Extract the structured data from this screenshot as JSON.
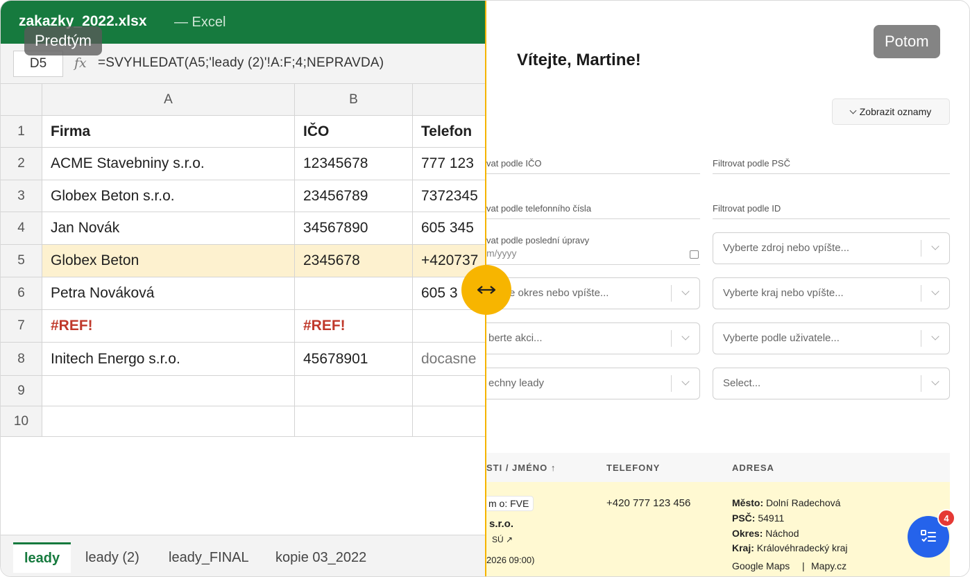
{
  "excel": {
    "file_name": "zakazky_2022.xlsx",
    "app_name": "— Excel",
    "cell_ref": "D5",
    "fx_label": "fx",
    "formula": "=SVYHLEDAT(A5;'leady (2)'!A:F;4;NEPRAVDA)",
    "columns": [
      "A",
      "B",
      ""
    ],
    "rows": [
      {
        "num": "1",
        "a": "Firma",
        "b": "IČO",
        "c": "Telefon"
      },
      {
        "num": "2",
        "a": "ACME Stavebniny s.r.o.",
        "b": "12345678",
        "c": "777 123"
      },
      {
        "num": "3",
        "a": "Globex Beton s.r.o.",
        "b": "23456789",
        "c": "7372345"
      },
      {
        "num": "4",
        "a": "Jan Novák",
        "b": "34567890",
        "c": "605 345"
      },
      {
        "num": "5",
        "a": "Globex Beton",
        "b": "2345678",
        "c": "+420737"
      },
      {
        "num": "6",
        "a": "Petra Nováková",
        "b": "",
        "c": "605 3"
      },
      {
        "num": "7",
        "a": "#REF!",
        "b": "#REF!",
        "c": ""
      },
      {
        "num": "8",
        "a": "Initech Energo s.r.o.",
        "b": "45678901",
        "c": "docasne"
      },
      {
        "num": "9",
        "a": "",
        "b": "",
        "c": ""
      },
      {
        "num": "10",
        "a": "",
        "b": "",
        "c": ""
      }
    ],
    "sheet_tabs": [
      "leady",
      "leady (2)",
      "leady_FINAL",
      "kopie 03_2022"
    ],
    "accent": "#167a3e"
  },
  "labels": {
    "before": "Predtým",
    "after": "Potom"
  },
  "app": {
    "welcome": "Vítejte, Martine!",
    "announce_button": "Zobrazit oznamy",
    "filters": {
      "ico": "vat podle IČO",
      "psc": "Filtrovat podle PSČ",
      "phone": "vat podle telefonního čísla",
      "id": "Filtrovat podle ID",
      "last_edit": "vat podle poslední úpravy",
      "date_placeholder": "m/yyyy"
    },
    "selects": {
      "source": "Vyberte zdroj nebo vpíšte...",
      "district": "e okres nebo vpíšte...",
      "region": "Vyberte kraj nebo vpíšte...",
      "action": "berte akci...",
      "user": "Vyberte podle uživatele...",
      "leads": "echny leady",
      "generic": "Select..."
    },
    "table": {
      "col_name": "STI / JMÉNO ↑",
      "col_phones": "TELEFONY",
      "col_address": "ADRESA",
      "row": {
        "tag": "m o: FVE",
        "company": "s.r.o.",
        "subtitle": "SÚ ↗",
        "date": "2026 09:00)",
        "phone": "+420 777 123 456",
        "city_label": "Město:",
        "city": "Dolní Radechová",
        "psc_label": "PSČ:",
        "psc": "54911",
        "district_label": "Okres:",
        "district": "Náchod",
        "region_label": "Kraj:",
        "region": "Královéhradecký kraj",
        "map1": "Google Maps",
        "map_sep": "|",
        "map2": "Mapy.cz"
      }
    },
    "fab_badge": "4"
  }
}
